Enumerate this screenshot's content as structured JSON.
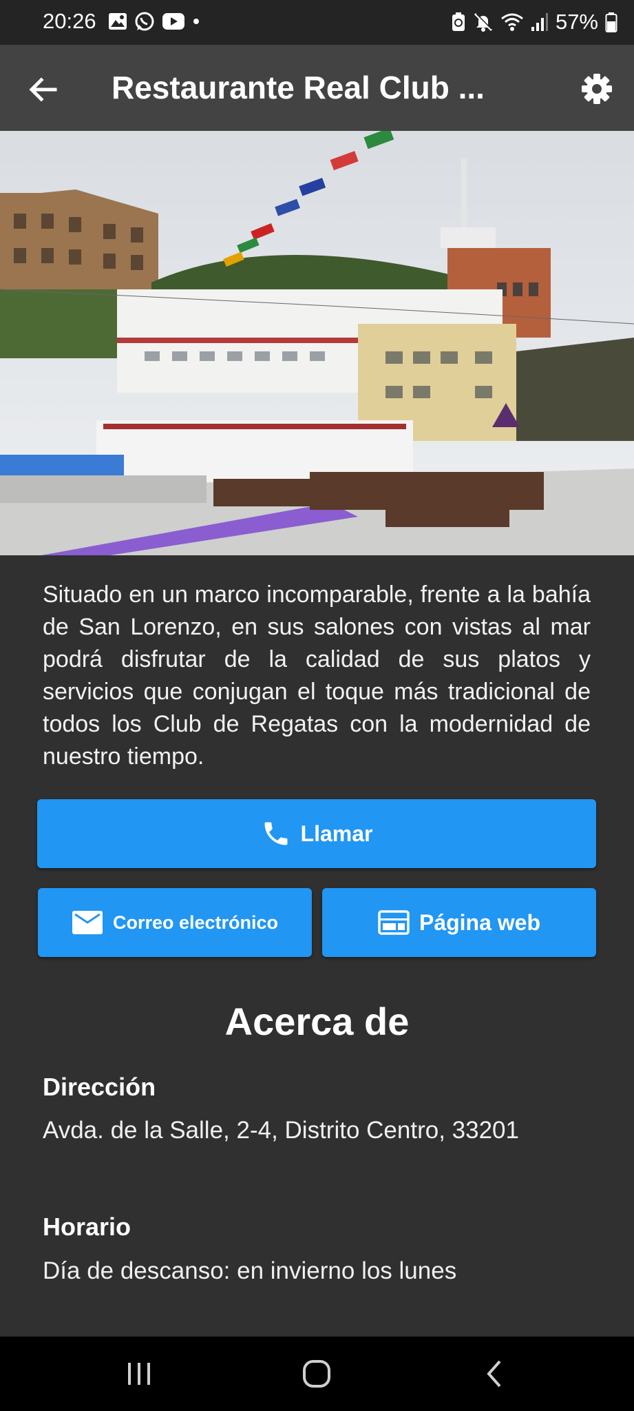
{
  "status_bar": {
    "time": "20:26",
    "battery": "57%",
    "left_icons": [
      "gallery-icon",
      "whatsapp-icon",
      "youtube-icon",
      "dot-icon"
    ],
    "right_icons": [
      "recycle-icon",
      "mute-icon",
      "wifi-icon",
      "signal-icon",
      "battery-icon"
    ]
  },
  "app_bar": {
    "title": "Restaurante Real Club ...",
    "back_icon": "arrow-left-icon",
    "settings_icon": "gear-icon"
  },
  "description": "Situado en un marco incomparable, frente a la bahía de San Lorenzo, en sus salones con vistas al mar podrá disfrutar de la calidad de sus platos y servicios que conjugan el toque más tradicional de todos los Club de Regatas con la modernidad de nuestro tiempo.",
  "actions": {
    "call_label": "Llamar",
    "email_label": "Correo electrónico",
    "web_label": "Página web",
    "accent": "#2196f3"
  },
  "about": {
    "title": "Acerca de",
    "address_label": "Dirección",
    "address_value": "Avda. de la Salle, 2-4, Distrito Centro, 33201",
    "hours_label": "Horario",
    "hours_value": "Día de descanso: en invierno los lunes"
  }
}
